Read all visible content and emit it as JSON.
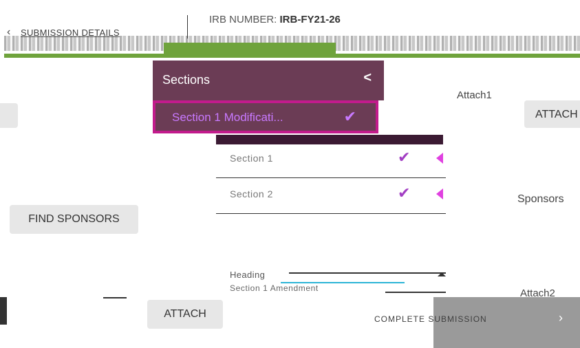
{
  "header": {
    "back_label": "SUBMISSION DETAILS",
    "irb_label": "IRB NUMBER: ",
    "irb_value": "IRB-FY21-26"
  },
  "sections_panel": {
    "title": "Sections",
    "active_label": "Section 1 Modificati..."
  },
  "section_list": [
    {
      "label": "Section 1"
    },
    {
      "label": "Section 2"
    }
  ],
  "right_column": {
    "attach1_label": "Attach1",
    "attach_button": "ATTACH",
    "sponsors_label": "Sponsors",
    "attach2_label": "Attach2"
  },
  "left_column": {
    "find_sponsors_button": "FIND SPONSORS",
    "attach_button": "ATTACH"
  },
  "heading_field": {
    "label": "Heading",
    "sub_label": "Section 1 Amendment"
  },
  "footer": {
    "complete_button": "COMPLETE SUBMISSION"
  },
  "colors": {
    "panel": "#6b3c55",
    "active_border": "#c21b8c",
    "check": "#a23ec3",
    "accent_green": "#6fa33c"
  }
}
